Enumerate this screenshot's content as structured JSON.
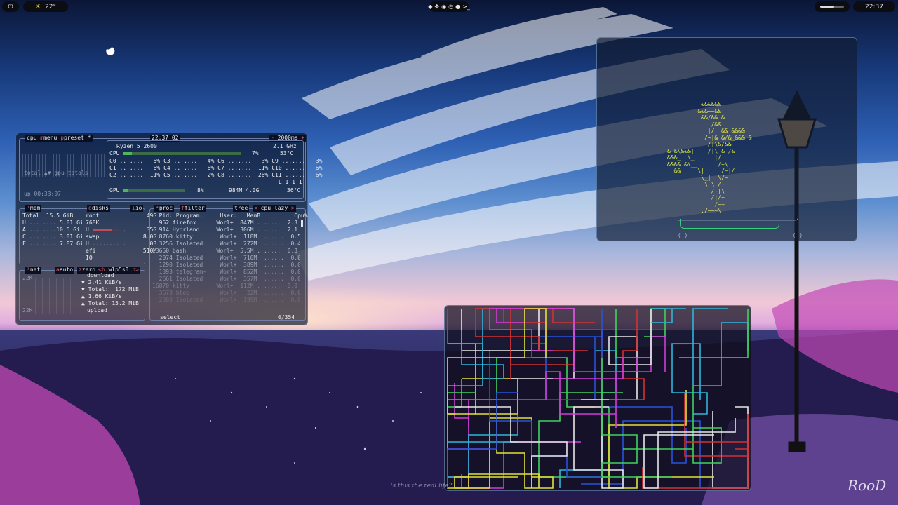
{
  "topbar": {
    "power_icon": "power-icon",
    "weather_icon": "sun-icon",
    "temperature": "22°",
    "tray_icons": [
      "display-icon",
      "move-icon",
      "discord-icon",
      "clock-icon",
      "steam-icon",
      "terminal-icon"
    ],
    "clock": "22:37"
  },
  "btop": {
    "cpu_box": {
      "tab_cpu": "cpu",
      "tab_menu": "menu",
      "tab_preset": "preset",
      "preset_marker": "*",
      "clock": "22:37:02",
      "interval": "2000ms",
      "cpu_model": "Ryzen 5 2600",
      "freq": "2.1 GHz",
      "graph_label": "total ▲▼ gpu-totals",
      "uptime": "up 00:33:07",
      "cpu_row": {
        "label": "CPU",
        "pct": "7%",
        "temp": "53°C",
        "fill": 0.07
      },
      "cores": [
        "C0 .......   5% C3 .......   4% C6 .......   3% C9 .......   3%",
        "C1 .......   6% C4 .......   6% C7 .......  11% C10 ......   6%",
        "C2 .......  11% C5 .......   2% C8 .......  26% C11 ......   6%",
        "                                                  L 1 1 1"
      ],
      "gpu_row": {
        "label": "GPU",
        "pct": "8%",
        "mem": "984M 4.0G",
        "temp": "36°C",
        "fill": 0.08
      }
    },
    "mem_box": {
      "tab_mem": "mem",
      "tab_disks": "disks",
      "tab_io": "io",
      "total": "Total: 15.5 GiB",
      "rows": [
        "U ........ 5.01 Gi",
        "A ........10.5 Gi",
        "C ........ 3.01 Gi",
        "F ........ 7.87 Gi"
      ]
    },
    "disks": [
      "root              49G",
      "768K",
      "U ..........      35G",
      "swap             8.0G",
      "U ..........       0B",
      "efi              510M",
      "IO"
    ],
    "net_box": {
      "tab_net": "net",
      "tab_auto": "auto",
      "tab_zero": "zero",
      "tab_prev": "<b",
      "interface": "wlp5s0",
      "tab_next": "n>",
      "scale_top": "22K",
      "scale_bottom": "22K",
      "lines": [
        "download",
        "▼ 2.41 KiB/s",
        "▼ Total:  172 MiB",
        "▲ 1.66 KiB/s",
        "▲ Total: 15.2 MiB",
        "upload"
      ]
    },
    "proc_box": {
      "tab_proc": "proc",
      "tab_filter": "filter",
      "tab_tree": "tree",
      "tab_prev": "<",
      "sort": "cpu lazy",
      "tab_next": ">",
      "header": "  Pid: Program:     User:   MemB          Cpu%",
      "rows": [
        "  952 firefox      Worl+  847M .......  2.3",
        "  914 Hyprland     Worl+  306M .......  2.1",
        "  8760 kitty        Worl+  118M .......  0.5",
        "  3256 Isolated     Worl+  272M .......  0.4",
        "13650 bash         Worl+  5.5M .......  0.3",
        "  2074 Isolated     Worl+  710M .......  0.0",
        "  1290 Isolated     Worl+  389M .......  0.0",
        "  1393 telegram-    Worl+  852M .......  0.0",
        "  2661 Isolated     Worl+  357M .......  0.0",
        "16870 kitty        Worl+  112M .......  0.0",
        "  3678 btop         Worl+   22M .......  0.0",
        "  2380 Isolated     Worl+  199M .......  0.0"
      ],
      "footer_select": "select",
      "footer_count": "0/354"
    }
  },
  "bonsai": {
    "art": [
      "          &&&&&&",
      "         &&&~~&&",
      "          &&/&& &",
      "             /&&",
      "            |/  && &&&&",
      "           /~|& &/&_&&& &",
      "            /|\\&/&&",
      "& &\\&&&|    /|\\ &_/&",
      "&&&_  \\_      |/",
      "&&&& &\\__      /~\\",
      "  &&     \\|     /~|/",
      "          \\_|  \\/~",
      "           \\_\\ /~",
      "             /~|\\",
      "             /|/~",
      "              /~~",
      "          ./~~~\\."
    ],
    "pot_top": ":___________________________________:",
    "pot_bottom": " (_)                               (_)"
  },
  "pipes": {
    "colors": [
      "#3fd35a",
      "#2fb5d8",
      "#d23232",
      "#d23cd8",
      "#e2e23a",
      "#2a52d8",
      "#e8e8e8"
    ]
  },
  "watermark": "Is this the real life?",
  "signature": "RooD"
}
